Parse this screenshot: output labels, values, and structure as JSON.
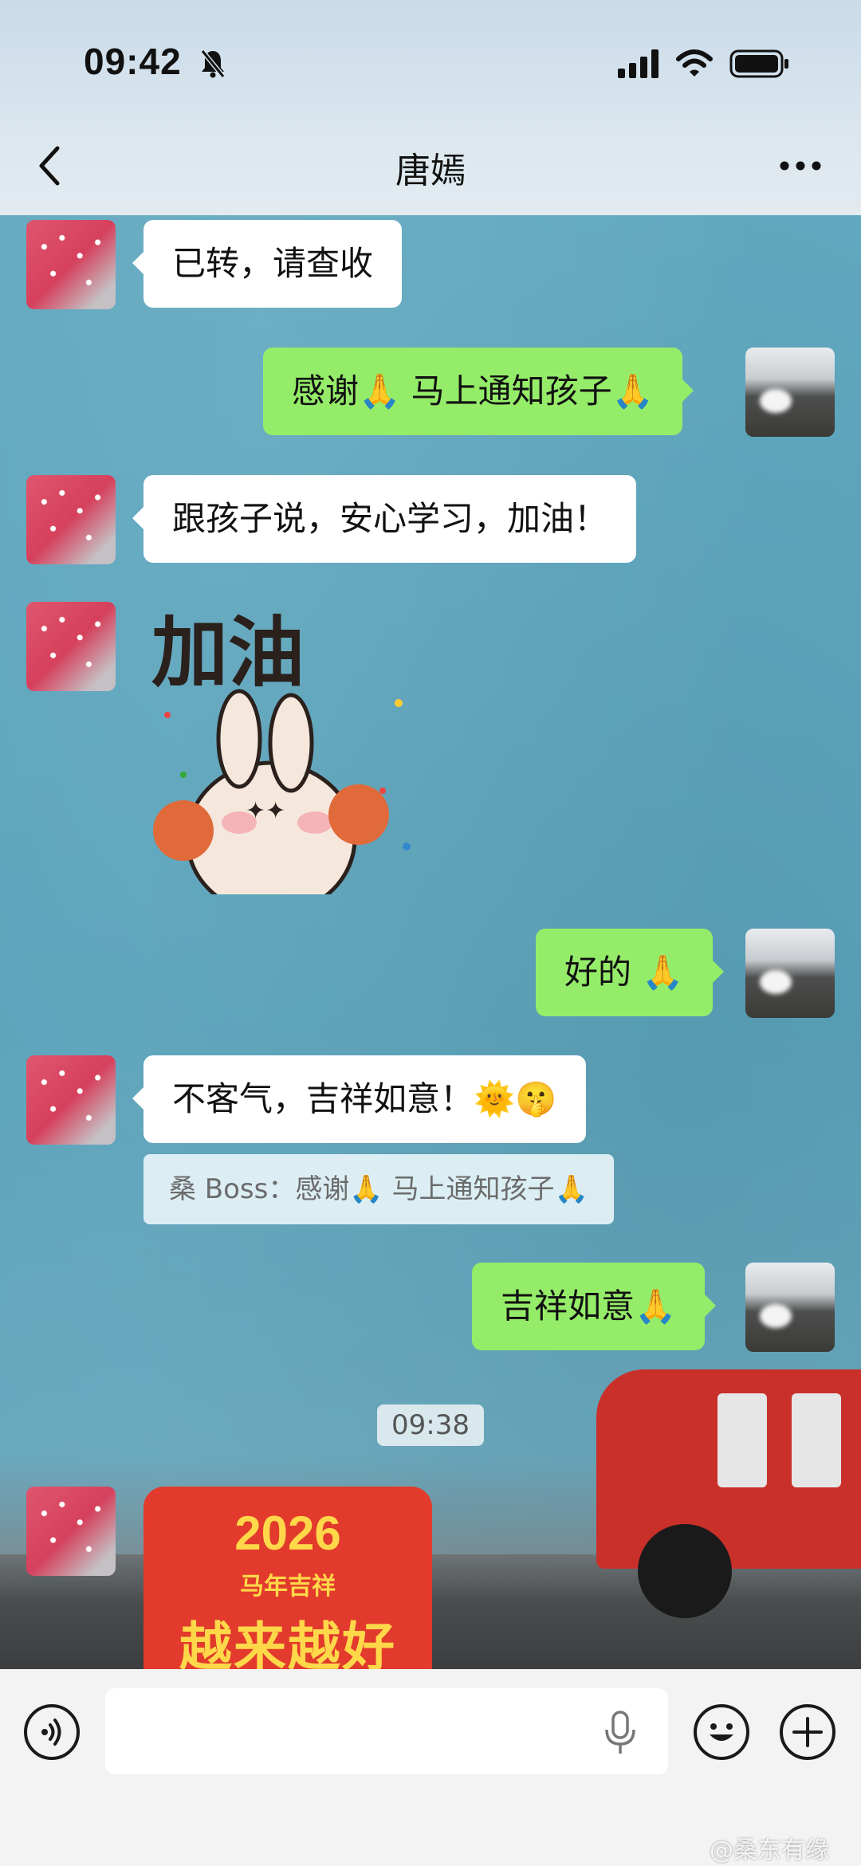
{
  "status_bar": {
    "time": "09:42",
    "icons": [
      "bell-off-icon",
      "signal-icon",
      "wifi-icon",
      "battery-icon"
    ]
  },
  "header": {
    "title": "唐嫣",
    "back_icon": "chevron-left-icon",
    "more_icon": "more-horizontal-icon"
  },
  "messages": [
    {
      "side": "left",
      "type": "text",
      "text": "已转，请查收"
    },
    {
      "side": "right",
      "type": "text",
      "text": "感谢🙏 马上通知孩子🙏"
    },
    {
      "side": "left",
      "type": "text",
      "text": "跟孩子说，安心学习，加油！"
    },
    {
      "side": "left",
      "type": "sticker",
      "text": "加油"
    },
    {
      "side": "right",
      "type": "text",
      "text": "好的 🙏"
    },
    {
      "side": "left",
      "type": "text",
      "text": "不客气，吉祥如意！🌞🤫"
    },
    {
      "side": "left",
      "type": "quote",
      "text": "桑 Boss：感谢🙏 马上通知孩子🙏"
    },
    {
      "side": "right",
      "type": "text",
      "text": "吉祥如意🙏"
    },
    {
      "side": "left",
      "type": "sticker",
      "year": "2026",
      "sub": "马年吉祥",
      "main": "越来越好"
    }
  ],
  "timestamp": "09:38",
  "input_bar": {
    "voice_icon": "voice-mode-icon",
    "mic_icon": "microphone-icon",
    "emoji_icon": "emoji-icon",
    "plus_icon": "plus-icon",
    "value": ""
  },
  "watermark": "@桑东有缘",
  "colors": {
    "bubble_left": "#ffffff",
    "bubble_right": "#95ec69",
    "wallpaper": "#5fa7bd"
  }
}
